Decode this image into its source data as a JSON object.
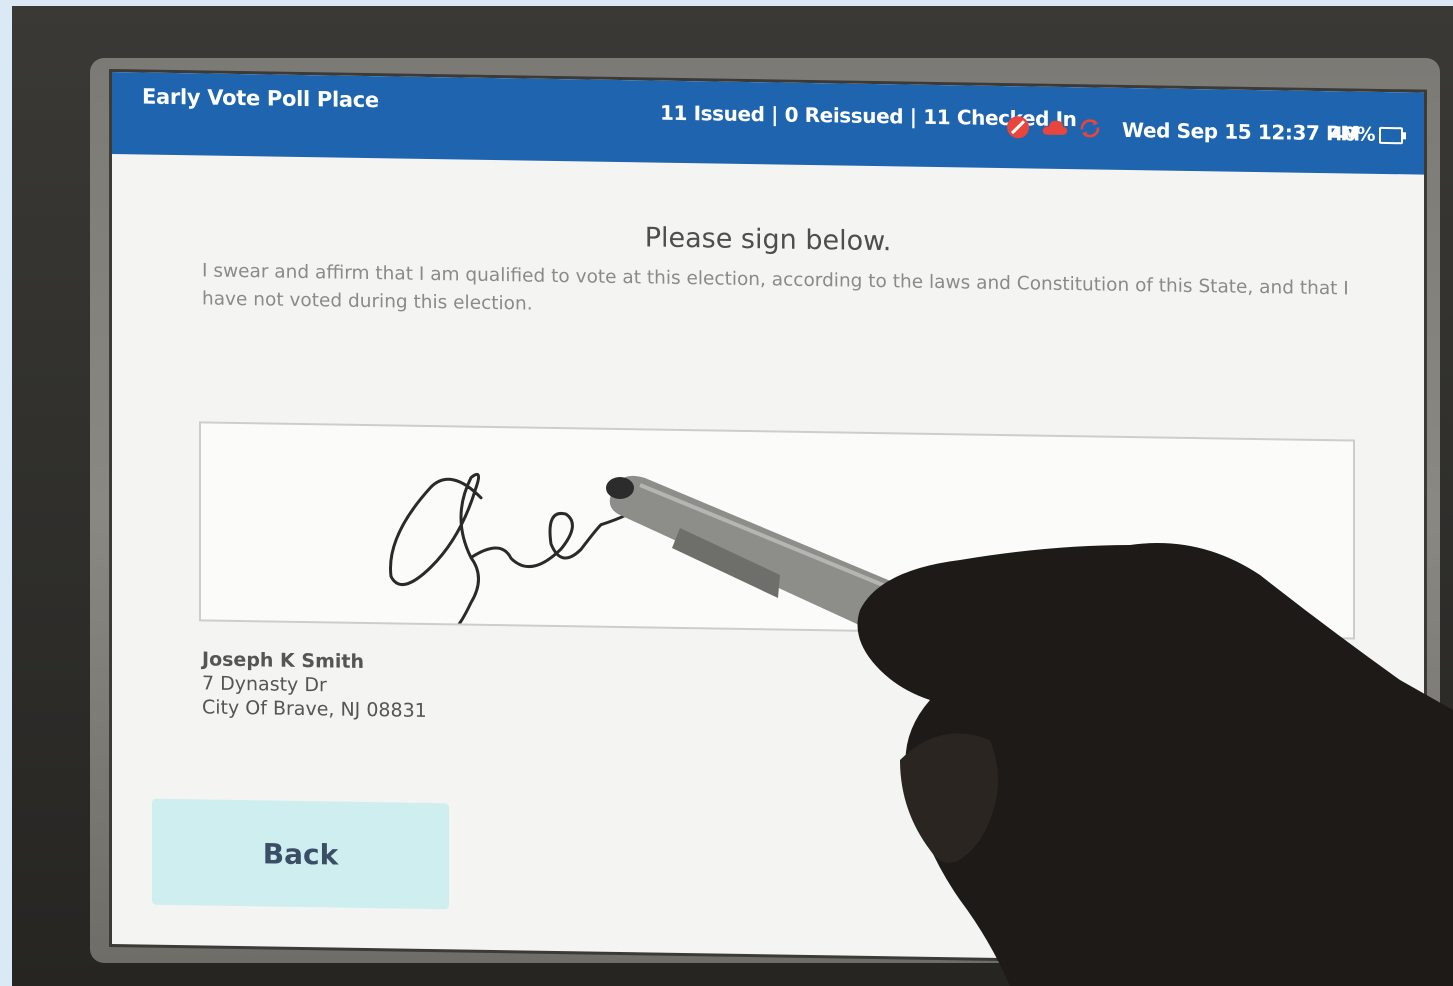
{
  "header": {
    "location": "Early Vote Poll Place",
    "counts": "11 Issued | 0 Reissued | 11 Checked In",
    "datetime": "Wed Sep 15  12:37 PM",
    "battery": "40%"
  },
  "status_icons": [
    "no-entry-icon",
    "cloud-icon",
    "sync-icon"
  ],
  "main": {
    "title": "Please sign below.",
    "oath": "I swear and affirm that I am qualified to vote at this election, according to the laws and Constitution of this State, and that I have not voted during this election."
  },
  "voter": {
    "name": "Joseph K Smith",
    "address_line1": "7 Dynasty Dr",
    "address_line2": "City Of Brave, NJ 08831"
  },
  "buttons": {
    "back": "Back"
  },
  "colors": {
    "header": "#1f64ae",
    "status_red": "#e8453c",
    "back_button": "#cfeef0"
  }
}
